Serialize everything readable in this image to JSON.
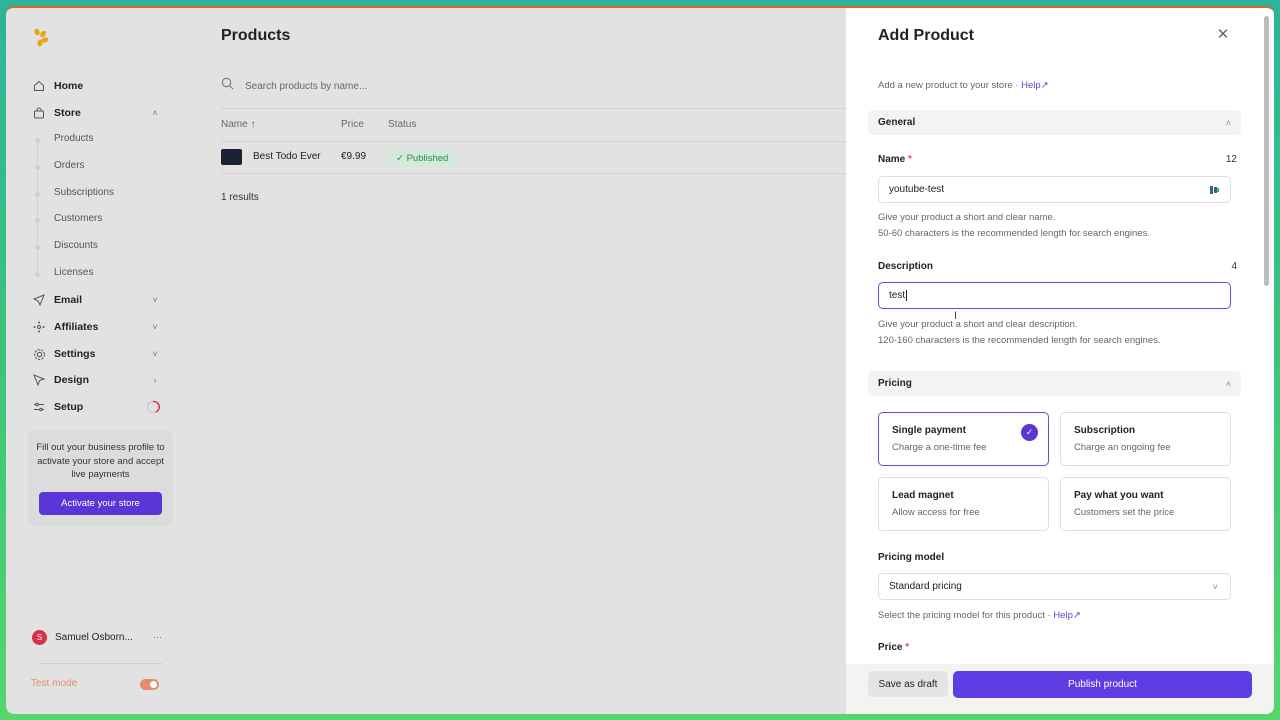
{
  "sidebar": {
    "nav": [
      {
        "label": "Home",
        "icon": "home-icon"
      },
      {
        "label": "Store",
        "icon": "shopping-bag-icon",
        "chevron": "˄"
      },
      {
        "label": "Email",
        "icon": "send-icon",
        "chevron": "˅"
      },
      {
        "label": "Affiliates",
        "icon": "affiliates-icon",
        "chevron": "˅"
      },
      {
        "label": "Settings",
        "icon": "gear-icon",
        "chevron": "˅"
      },
      {
        "label": "Design",
        "icon": "cursor-icon",
        "chevron": "›"
      },
      {
        "label": "Setup",
        "icon": "sliders-icon"
      }
    ],
    "store_sub": [
      "Products",
      "Orders",
      "Subscriptions",
      "Customers",
      "Discounts",
      "Licenses"
    ],
    "promo": {
      "text": "Fill out your business profile to activate your store and accept live payments",
      "button": "Activate your store"
    },
    "user": {
      "initial": "S",
      "name": "Samuel Osborn...",
      "more": "···"
    },
    "test_mode": {
      "label": "Test mode",
      "enabled": true
    }
  },
  "main": {
    "title": "Products",
    "search_placeholder": "Search products by name...",
    "columns": {
      "name": "Name ↑",
      "price": "Price",
      "status": "Status"
    },
    "rows": [
      {
        "name": "Best Todo Ever",
        "price": "€9.99",
        "status": "✓ Published"
      }
    ],
    "results": "1 results"
  },
  "panel": {
    "title": "Add Product",
    "close": "✕",
    "subtitle": "Add a new product to your store · ",
    "help": "Help↗",
    "general": {
      "title": "General",
      "chevron": "˄"
    },
    "name": {
      "label": "Name",
      "required": "*",
      "count": "12",
      "value": "youtube-test",
      "help1": "Give your product a short and clear name.",
      "help2": "50-60 characters is the recommended length for search engines."
    },
    "description": {
      "label": "Description",
      "count": "4",
      "value": "test",
      "help1": "Give your product a short and clear description.",
      "help2": "120-160 characters is the recommended length for search engines."
    },
    "pricing": {
      "title": "Pricing",
      "chevron": "˄"
    },
    "options": [
      {
        "title": "Single payment",
        "desc": "Charge a one-time fee",
        "selected": true
      },
      {
        "title": "Subscription",
        "desc": "Charge an ongoing fee",
        "selected": false
      },
      {
        "title": "Lead magnet",
        "desc": "Allow access for free",
        "selected": false
      },
      {
        "title": "Pay what you want",
        "desc": "Customers set the price",
        "selected": false
      }
    ],
    "pricing_model": {
      "label": "Pricing model",
      "value": "Standard pricing",
      "help": "Select the pricing model for this product · ",
      "help_link": "Help↗"
    },
    "price": {
      "label": "Price",
      "required": "*"
    },
    "footer": {
      "draft": "Save as draft",
      "publish": "Publish product"
    }
  },
  "colors": {
    "accent": "#5e3ce3",
    "published": "#2e8d4f",
    "required": "#e34c5a",
    "avatar": "#d6304a"
  }
}
